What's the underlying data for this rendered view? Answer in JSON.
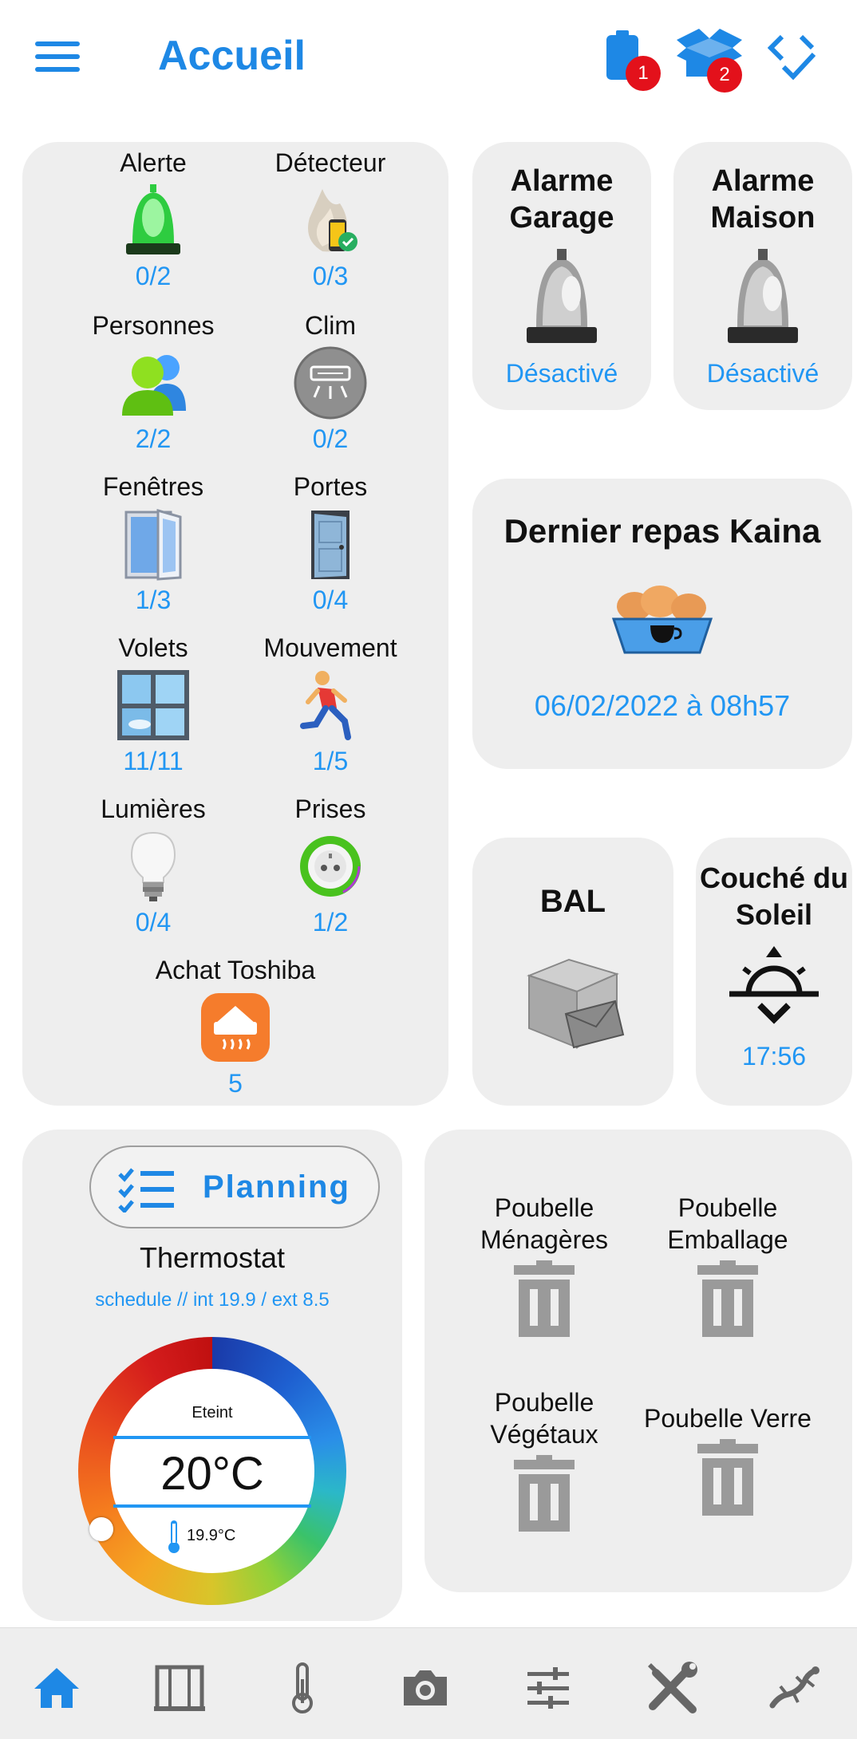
{
  "header": {
    "title": "Accueil",
    "battery_badge": "1",
    "box_badge": "2"
  },
  "status_grid": {
    "items": [
      {
        "label": "Alerte",
        "value": "0/2",
        "icon": "siren-icon"
      },
      {
        "label": "Détecteur",
        "value": "0/3",
        "icon": "smoke-detector-icon"
      },
      {
        "label": "Personnes",
        "value": "2/2",
        "icon": "people-icon"
      },
      {
        "label": "Clim",
        "value": "0/2",
        "icon": "air-conditioner-icon"
      },
      {
        "label": "Fenêtres",
        "value": "1/3",
        "icon": "window-icon"
      },
      {
        "label": "Portes",
        "value": "0/4",
        "icon": "door-icon"
      },
      {
        "label": "Volets",
        "value": "11/11",
        "icon": "shutters-icon"
      },
      {
        "label": "Mouvement",
        "value": "1/5",
        "icon": "motion-icon"
      },
      {
        "label": "Lumières",
        "value": "0/4",
        "icon": "light-bulb-icon"
      },
      {
        "label": "Prises",
        "value": "1/2",
        "icon": "power-outlet-icon"
      }
    ],
    "toshiba": {
      "label": "Achat Toshiba",
      "value": "5",
      "icon": "heater-icon"
    }
  },
  "alarms": {
    "garage": {
      "title": "Alarme Garage",
      "state": "Désactivé"
    },
    "maison": {
      "title": "Alarme Maison",
      "state": "Désactivé"
    }
  },
  "meal": {
    "title": "Dernier repas Kaina",
    "date": "06/02/2022 à 08h57"
  },
  "bal": {
    "title": "BAL"
  },
  "sunset": {
    "title": "Couché du Soleil",
    "time": "17:56"
  },
  "thermostat": {
    "planning_label": "Planning",
    "title": "Thermostat",
    "info": "schedule // int 19.9 / ext 8.5",
    "mode": "Eteint",
    "setpoint": "20°C",
    "current": "19.9°C"
  },
  "bins": [
    {
      "label": "Poubelle Ménagères"
    },
    {
      "label": "Poubelle Emballage"
    },
    {
      "label": "Poubelle Végétaux"
    },
    {
      "label": "Poubelle Verre"
    }
  ],
  "nav": [
    "home-icon",
    "building-icon",
    "thermometer-icon",
    "camera-icon",
    "sliders-icon",
    "tools-icon",
    "gecko-icon"
  ],
  "colors": {
    "accent": "#1e88e5",
    "value_blue": "#2196f3",
    "card_bg": "#eeeeee",
    "badge_red": "#e3111b"
  }
}
